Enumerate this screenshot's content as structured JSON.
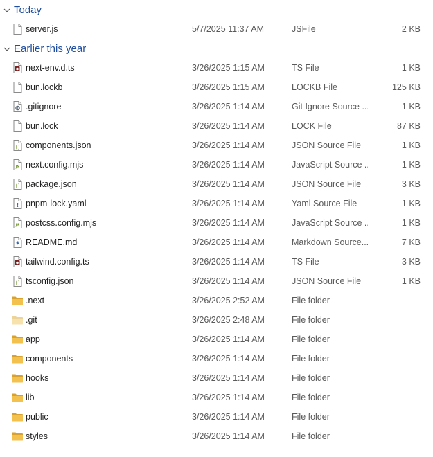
{
  "groups": [
    {
      "title": "Today",
      "items": [
        {
          "name": "server.js",
          "date": "5/7/2025 11:37 AM",
          "type": "JSFile",
          "size": "2 KB",
          "icon": "blank-file-icon"
        }
      ]
    },
    {
      "title": "Earlier this year",
      "items": [
        {
          "name": "next-env.d.ts",
          "date": "3/26/2025 1:15 AM",
          "type": "TS File",
          "size": "1 KB",
          "icon": "ts-file-icon"
        },
        {
          "name": "bun.lockb",
          "date": "3/26/2025 1:15 AM",
          "type": "LOCKB File",
          "size": "125 KB",
          "icon": "blank-file-icon"
        },
        {
          "name": ".gitignore",
          "date": "3/26/2025 1:14 AM",
          "type": "Git Ignore Source ...",
          "size": "1 KB",
          "icon": "gear-file-icon"
        },
        {
          "name": "bun.lock",
          "date": "3/26/2025 1:14 AM",
          "type": "LOCK File",
          "size": "87 KB",
          "icon": "blank-file-icon"
        },
        {
          "name": "components.json",
          "date": "3/26/2025 1:14 AM",
          "type": "JSON Source File",
          "size": "1 KB",
          "icon": "json-file-icon"
        },
        {
          "name": "next.config.mjs",
          "date": "3/26/2025 1:14 AM",
          "type": "JavaScript Source ...",
          "size": "1 KB",
          "icon": "js-file-icon"
        },
        {
          "name": "package.json",
          "date": "3/26/2025 1:14 AM",
          "type": "JSON Source File",
          "size": "3 KB",
          "icon": "json-file-icon"
        },
        {
          "name": "pnpm-lock.yaml",
          "date": "3/26/2025 1:14 AM",
          "type": "Yaml Source File",
          "size": "1 KB",
          "icon": "yaml-file-icon"
        },
        {
          "name": "postcss.config.mjs",
          "date": "3/26/2025 1:14 AM",
          "type": "JavaScript Source ...",
          "size": "1 KB",
          "icon": "js-file-icon"
        },
        {
          "name": "README.md",
          "date": "3/26/2025 1:14 AM",
          "type": "Markdown Source...",
          "size": "7 KB",
          "icon": "markdown-file-icon"
        },
        {
          "name": "tailwind.config.ts",
          "date": "3/26/2025 1:14 AM",
          "type": "TS File",
          "size": "3 KB",
          "icon": "ts-file-icon"
        },
        {
          "name": "tsconfig.json",
          "date": "3/26/2025 1:14 AM",
          "type": "JSON Source File",
          "size": "1 KB",
          "icon": "json-file-icon"
        },
        {
          "name": ".next",
          "date": "3/26/2025 2:52 AM",
          "type": "File folder",
          "size": "",
          "icon": "folder-icon"
        },
        {
          "name": ".git",
          "date": "3/26/2025 2:48 AM",
          "type": "File folder",
          "size": "",
          "icon": "folder-faded-icon"
        },
        {
          "name": "app",
          "date": "3/26/2025 1:14 AM",
          "type": "File folder",
          "size": "",
          "icon": "folder-icon"
        },
        {
          "name": "components",
          "date": "3/26/2025 1:14 AM",
          "type": "File folder",
          "size": "",
          "icon": "folder-icon"
        },
        {
          "name": "hooks",
          "date": "3/26/2025 1:14 AM",
          "type": "File folder",
          "size": "",
          "icon": "folder-icon"
        },
        {
          "name": "lib",
          "date": "3/26/2025 1:14 AM",
          "type": "File folder",
          "size": "",
          "icon": "folder-icon"
        },
        {
          "name": "public",
          "date": "3/26/2025 1:14 AM",
          "type": "File folder",
          "size": "",
          "icon": "folder-icon"
        },
        {
          "name": "styles",
          "date": "3/26/2025 1:14 AM",
          "type": "File folder",
          "size": "",
          "icon": "folder-icon"
        }
      ]
    }
  ],
  "colors": {
    "group_title": "#1e4e9d",
    "folder": "#f2c14e",
    "folder_dark": "#d9a12e",
    "hover": "#e5f3ff"
  }
}
